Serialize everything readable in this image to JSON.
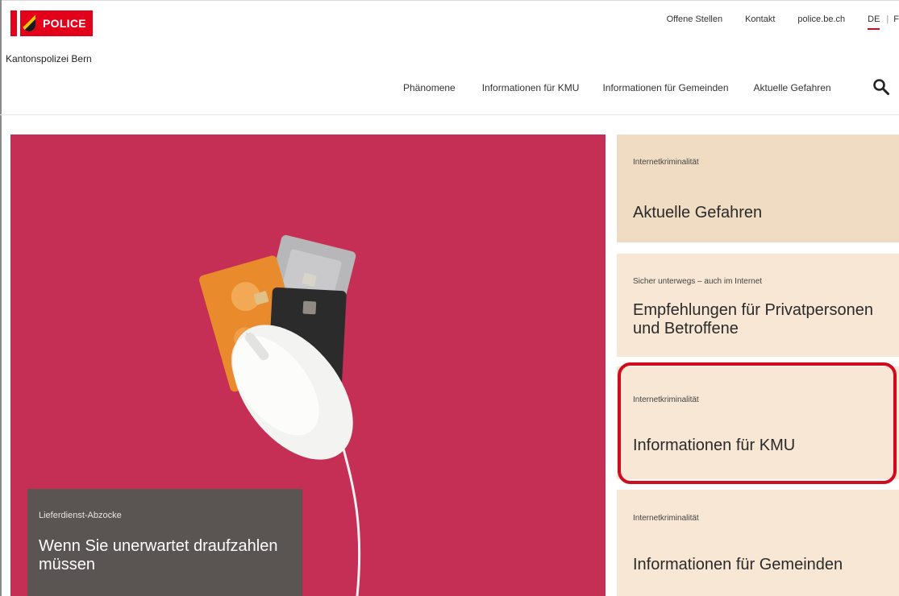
{
  "brand": {
    "logo_text": "POLICE",
    "name": "Kantonspolizei Bern"
  },
  "top_nav": {
    "items": [
      "Offene Stellen",
      "Kontakt",
      "police.be.ch"
    ],
    "lang_active": "DE",
    "lang_separator": "|",
    "lang_next": "F"
  },
  "main_nav": {
    "items": [
      "Phänomene",
      "Informationen für KMU",
      "Informationen für Gemeinden",
      "Aktuelle Gefahren"
    ]
  },
  "hero": {
    "kicker": "Lieferdienst-Abzocke",
    "title": "Wenn Sie unerwartet draufzahlen müssen"
  },
  "cards": [
    {
      "kicker": "Internetkriminalität",
      "title": "Aktuelle Gefahren"
    },
    {
      "kicker": "Sicher unterwegs – auch im Internet",
      "title": "Empfehlungen für Privatpersonen und Betroffene"
    },
    {
      "kicker": "Internetkriminalität",
      "title": "Informationen für KMU"
    },
    {
      "kicker": "Internetkriminalität",
      "title": "Informationen für Gemeinden"
    }
  ],
  "colors": {
    "brand_red": "#e2001a",
    "hero_bg": "#c52f56",
    "card_bg": "#f7e7d4",
    "highlight": "#d10b1f"
  }
}
